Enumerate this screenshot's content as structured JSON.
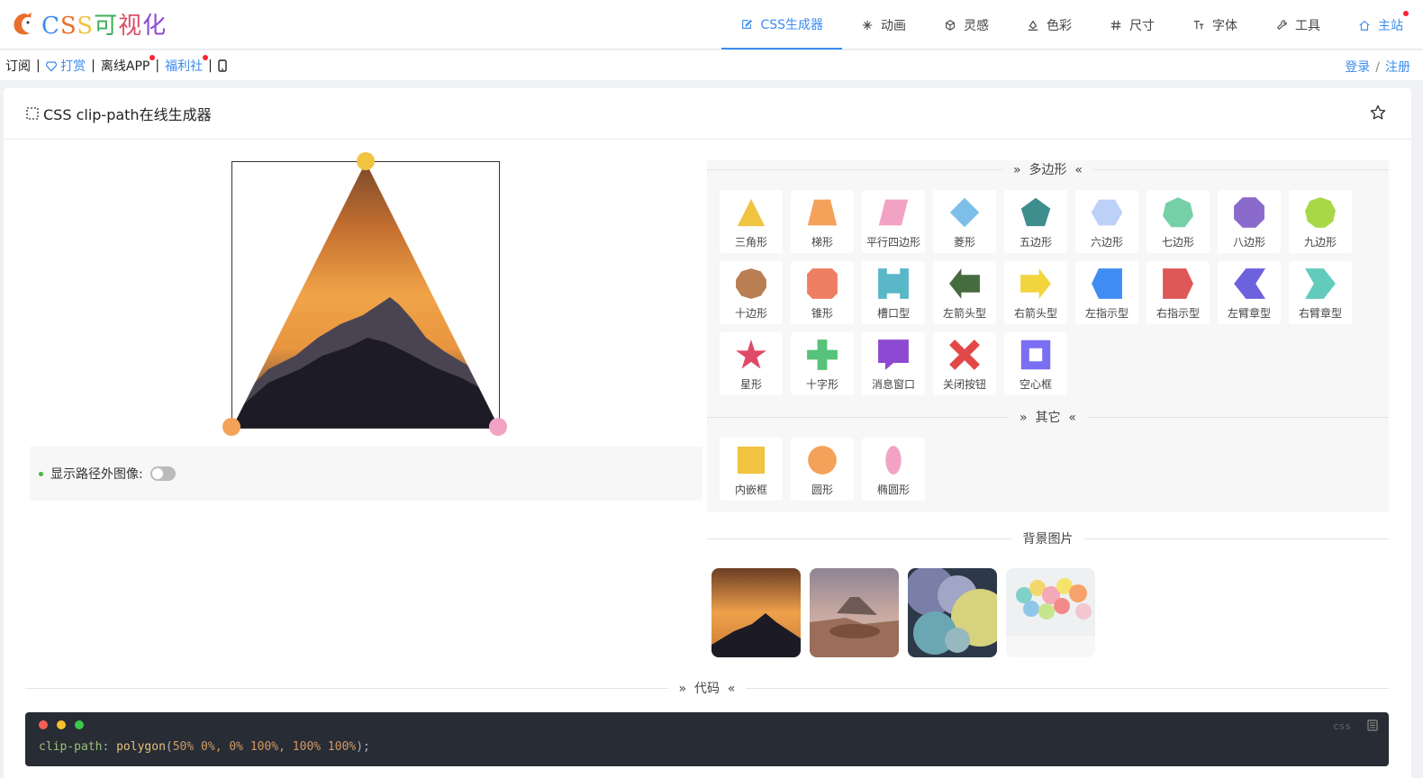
{
  "logo": {
    "letters": "CSS可视化"
  },
  "nav": [
    {
      "label": "CSS生成器",
      "icon": "edit-icon",
      "active": true
    },
    {
      "label": "动画",
      "icon": "animation-icon"
    },
    {
      "label": "灵感",
      "icon": "cube-icon"
    },
    {
      "label": "色彩",
      "icon": "paint-icon"
    },
    {
      "label": "尺寸",
      "icon": "hash-icon"
    },
    {
      "label": "字体",
      "icon": "font-size-icon"
    },
    {
      "label": "工具",
      "icon": "wrench-icon"
    },
    {
      "label": "主站",
      "icon": "home-icon"
    }
  ],
  "subbar": {
    "subscribe": "订阅",
    "reward": "打赏",
    "offline_app": "离线APP",
    "welfare": "福利社",
    "login": "登录",
    "register": "注册"
  },
  "card": {
    "title": "CSS clip-path在线生成器"
  },
  "options": {
    "show_outside_label": "显示路径外图像:",
    "show_outside": false
  },
  "sections": {
    "polygon": "多边形",
    "other": "其它",
    "background": "背景图片",
    "code": "代码"
  },
  "polygon_shapes": [
    {
      "label": "三角形",
      "color": "#f0c341"
    },
    {
      "label": "梯形",
      "color": "#f4a15a"
    },
    {
      "label": "平行四边形",
      "color": "#f2a3c4"
    },
    {
      "label": "菱形",
      "color": "#7dbfe8"
    },
    {
      "label": "五边形",
      "color": "#3e8e8e"
    },
    {
      "label": "六边形",
      "color": "#bcd0f8"
    },
    {
      "label": "七边形",
      "color": "#76d0a6"
    },
    {
      "label": "八边形",
      "color": "#8a6bcb"
    },
    {
      "label": "九边形",
      "color": "#a8d847"
    },
    {
      "label": "十边形",
      "color": "#b97e52"
    },
    {
      "label": "锥形",
      "color": "#ee7e62"
    },
    {
      "label": "槽口型",
      "color": "#5ab7c8"
    },
    {
      "label": "左箭头型",
      "color": "#456b3f"
    },
    {
      "label": "右箭头型",
      "color": "#f2d53d"
    },
    {
      "label": "左指示型",
      "color": "#3f8df2"
    },
    {
      "label": "右指示型",
      "color": "#df5858"
    },
    {
      "label": "左臂章型",
      "color": "#6d62dd"
    },
    {
      "label": "右臂章型",
      "color": "#62cbbb"
    },
    {
      "label": "星形",
      "color": "#e14968"
    },
    {
      "label": "十字形",
      "color": "#57c27a"
    },
    {
      "label": "消息窗口",
      "color": "#8e49d2"
    },
    {
      "label": "关闭按钮",
      "color": "#e34848"
    },
    {
      "label": "空心框",
      "color": "#7a6ff2"
    }
  ],
  "other_shapes": [
    {
      "label": "内嵌框",
      "color": "#f0c341"
    },
    {
      "label": "圆形",
      "color": "#f4a15a"
    },
    {
      "label": "椭圆形",
      "color": "#f2a3c4"
    }
  ],
  "code": {
    "lang": "css",
    "property": "clip-path",
    "fn": "polygon",
    "args": "50% 0%, 0% 100%, 100% 100%"
  }
}
